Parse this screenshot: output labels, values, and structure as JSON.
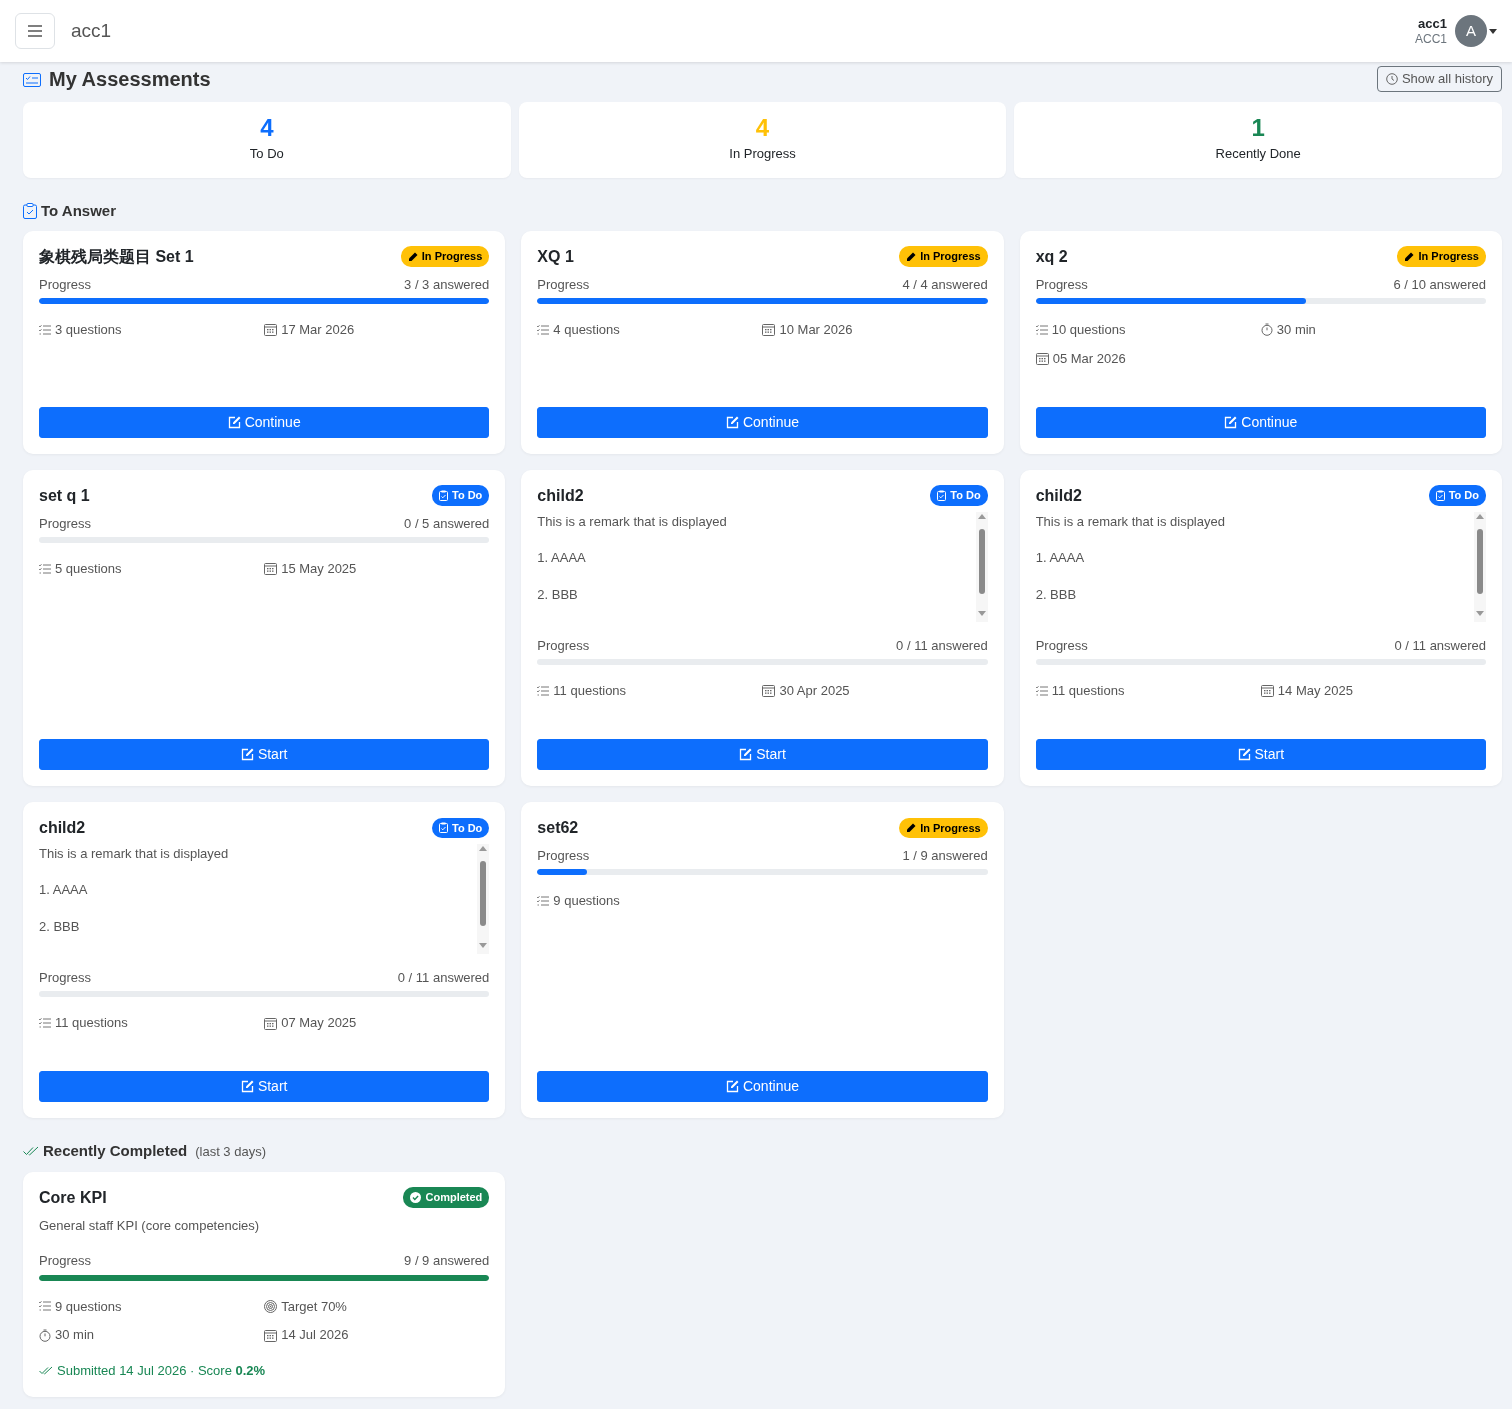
{
  "navbar": {
    "brand": "acc1",
    "user": {
      "name": "acc1",
      "code": "ACC1",
      "initial": "A"
    }
  },
  "page": {
    "title": "My Assessments",
    "history_button": "Show all history"
  },
  "stats": [
    {
      "value": "4",
      "label": "To Do",
      "color": "#0d6efd"
    },
    {
      "value": "4",
      "label": "In Progress",
      "color": "#ffc107"
    },
    {
      "value": "1",
      "label": "Recently Done",
      "color": "#198754"
    }
  ],
  "to_answer": {
    "title": "To Answer",
    "cards": [
      {
        "title": "象棋残局类题目 Set 1",
        "status": {
          "kind": "in_progress",
          "label": "In Progress"
        },
        "progress_label": "Progress",
        "answered": "3 / 3 answered",
        "level": 1,
        "meta": [
          {
            "kind": "questions",
            "text": "3 questions"
          },
          {
            "kind": "date",
            "text": "17 Mar 2026"
          }
        ],
        "button": "Continue"
      },
      {
        "title": "XQ 1",
        "status": {
          "kind": "in_progress",
          "label": "In Progress"
        },
        "progress_label": "Progress",
        "answered": "4 / 4 answered",
        "level": 1,
        "meta": [
          {
            "kind": "questions",
            "text": "4 questions"
          },
          {
            "kind": "date",
            "text": "10 Mar 2026"
          }
        ],
        "button": "Continue"
      },
      {
        "title": "xq 2",
        "status": {
          "kind": "in_progress",
          "label": "In Progress"
        },
        "progress_label": "Progress",
        "answered": "6 / 10 answered",
        "level": 0.6,
        "meta": [
          {
            "kind": "questions",
            "text": "10 questions"
          },
          {
            "kind": "duration",
            "text": "30 min"
          },
          {
            "kind": "date",
            "text": "05 Mar 2026"
          }
        ],
        "button": "Continue"
      },
      {
        "title": "set q 1",
        "status": {
          "kind": "todo",
          "label": "To Do"
        },
        "progress_label": "Progress",
        "answered": "0 / 5 answered",
        "level": 0,
        "meta": [
          {
            "kind": "questions",
            "text": "5 questions"
          },
          {
            "kind": "date",
            "text": "15 May 2025"
          }
        ],
        "button": "Start"
      },
      {
        "title": "child2",
        "status": {
          "kind": "todo",
          "label": "To Do"
        },
        "remark": [
          "This is a remark that is displayed",
          "1. AAAA",
          "2. BBB"
        ],
        "progress_label": "Progress",
        "answered": "0 / 11 answered",
        "level": 0,
        "meta": [
          {
            "kind": "questions",
            "text": "11 questions"
          },
          {
            "kind": "date",
            "text": "30 Apr 2025"
          }
        ],
        "button": "Start"
      },
      {
        "title": "child2",
        "status": {
          "kind": "todo",
          "label": "To Do"
        },
        "remark": [
          "This is a remark that is displayed",
          "1. AAAA",
          "2. BBB"
        ],
        "progress_label": "Progress",
        "answered": "0 / 11 answered",
        "level": 0,
        "meta": [
          {
            "kind": "questions",
            "text": "11 questions"
          },
          {
            "kind": "date",
            "text": "14 May 2025"
          }
        ],
        "button": "Start"
      },
      {
        "title": "child2",
        "status": {
          "kind": "todo",
          "label": "To Do"
        },
        "remark": [
          "This is a remark that is displayed",
          "1. AAAA",
          "2. BBB"
        ],
        "progress_label": "Progress",
        "answered": "0 / 11 answered",
        "level": 0,
        "meta": [
          {
            "kind": "questions",
            "text": "11 questions"
          },
          {
            "kind": "date",
            "text": "07 May 2025"
          }
        ],
        "button": "Start"
      },
      {
        "title": "set62",
        "status": {
          "kind": "in_progress",
          "label": "In Progress"
        },
        "progress_label": "Progress",
        "answered": "1 / 9 answered",
        "level": 0.11,
        "meta": [
          {
            "kind": "questions",
            "text": "9 questions"
          }
        ],
        "button": "Continue"
      }
    ]
  },
  "recently_completed": {
    "title": "Recently Completed",
    "note": "(last 3 days)",
    "cards": [
      {
        "title": "Core KPI",
        "status": {
          "kind": "completed",
          "label": "Completed"
        },
        "description": "General staff KPI (core competencies)",
        "progress_label": "Progress",
        "answered": "9 / 9 answered",
        "level": 1,
        "meta": [
          {
            "kind": "questions",
            "text": "9 questions"
          },
          {
            "kind": "target",
            "text": "Target 70%"
          },
          {
            "kind": "duration",
            "text": "30 min"
          },
          {
            "kind": "date",
            "text": "14 Jul 2026"
          }
        ],
        "submitted": "Submitted 14 Jul 2026 · Score **0.2%**"
      }
    ]
  }
}
